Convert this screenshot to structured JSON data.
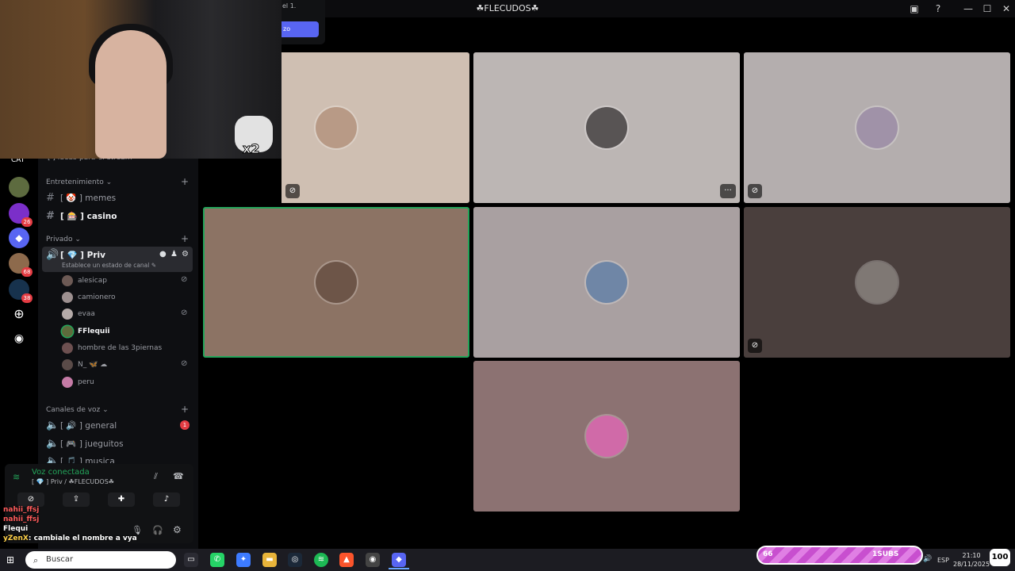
{
  "titlebar": {
    "server_name": "☘FLECUDOS☘",
    "icons": [
      "screen-share-icon",
      "help-icon"
    ],
    "minimize": "—",
    "maximize": "☐",
    "close": "✕"
  },
  "popup": {
    "text": "el 1.",
    "button": "zo"
  },
  "sidebar": {
    "top_partial": "[ ] ideas-para-el-stream",
    "category_partial": "CAT",
    "servers": [
      {
        "icon": "server-icon",
        "badge": ""
      },
      {
        "icon": "server-icon",
        "badge": "26"
      },
      {
        "icon": "discord-icon",
        "badge": ""
      },
      {
        "icon": "server-icon",
        "badge": "68"
      },
      {
        "icon": "server-icon",
        "badge": "38"
      },
      {
        "icon": "add-server-icon",
        "badge": ""
      },
      {
        "icon": "explore-icon",
        "badge": ""
      }
    ],
    "entretenimiento": {
      "label": "Entretenimiento ⌄",
      "channels": [
        "[ 🤡 ] memes",
        "[ 🎰 ] casino"
      ]
    },
    "privado": {
      "label": "Privado ⌄",
      "channel": "[ 💎 ] Priv",
      "status": "Establece un estado de canal ✎",
      "users": [
        {
          "name": "alesicap",
          "muted": true
        },
        {
          "name": "camionero",
          "muted": false
        },
        {
          "name": "evaa",
          "muted": true
        },
        {
          "name": "FFlequii",
          "muted": false,
          "speaking": true
        },
        {
          "name": "hombre de las 3piernas",
          "muted": false
        },
        {
          "name": "N_ 🦋 ☁",
          "muted": true
        },
        {
          "name": "peru",
          "muted": false
        }
      ]
    },
    "voz": {
      "label": "Canales de voz ⌄",
      "channels": [
        {
          "name": "[ 🔊 ] general",
          "badge": "1"
        },
        {
          "name": "[ 🎮 ] jueguitos",
          "badge": ""
        },
        {
          "name": "[ 🎵 ] musica",
          "badge": ""
        }
      ]
    },
    "voice_connected": {
      "title": "Voz conectada",
      "subtitle": "[ 💎 ] Priv / ☘FLECUDOS☘"
    }
  },
  "chat": [
    {
      "user": "nahii_ffsj",
      "text": "",
      "color": "#ff5c5c"
    },
    {
      "user": "nahii_ffsj",
      "text": "",
      "color": "#ff5c5c"
    },
    {
      "user": "Flequi",
      "text": "",
      "color": "#ffffff"
    },
    {
      "user": "yZenX",
      "text": ": cambiale el nombre a vya",
      "color": "#ffd24a"
    }
  ],
  "tiles": [
    {
      "bg": "#cfbfb2",
      "muted": true,
      "more": false
    },
    {
      "bg": "#bcb6b4",
      "muted": false,
      "more": true
    },
    {
      "bg": "#b4aeae",
      "muted": true,
      "more": false
    },
    {
      "bg": "#8c7364",
      "muted": false,
      "more": false,
      "speaking": true
    },
    {
      "bg": "#a9a0a1",
      "muted": false,
      "more": false
    },
    {
      "bg": "#4a3f3d",
      "muted": true,
      "more": false
    },
    {
      "bg": "#8c7272",
      "muted": false,
      "more": false
    }
  ],
  "cam": {
    "sticker": "x2"
  },
  "taskbar": {
    "search_placeholder": "Buscar",
    "lang": "ESP",
    "time": "21:10",
    "date": "28/11/2025",
    "widget_left": "66",
    "widget_mid": "1SUBS",
    "battery": "100"
  }
}
